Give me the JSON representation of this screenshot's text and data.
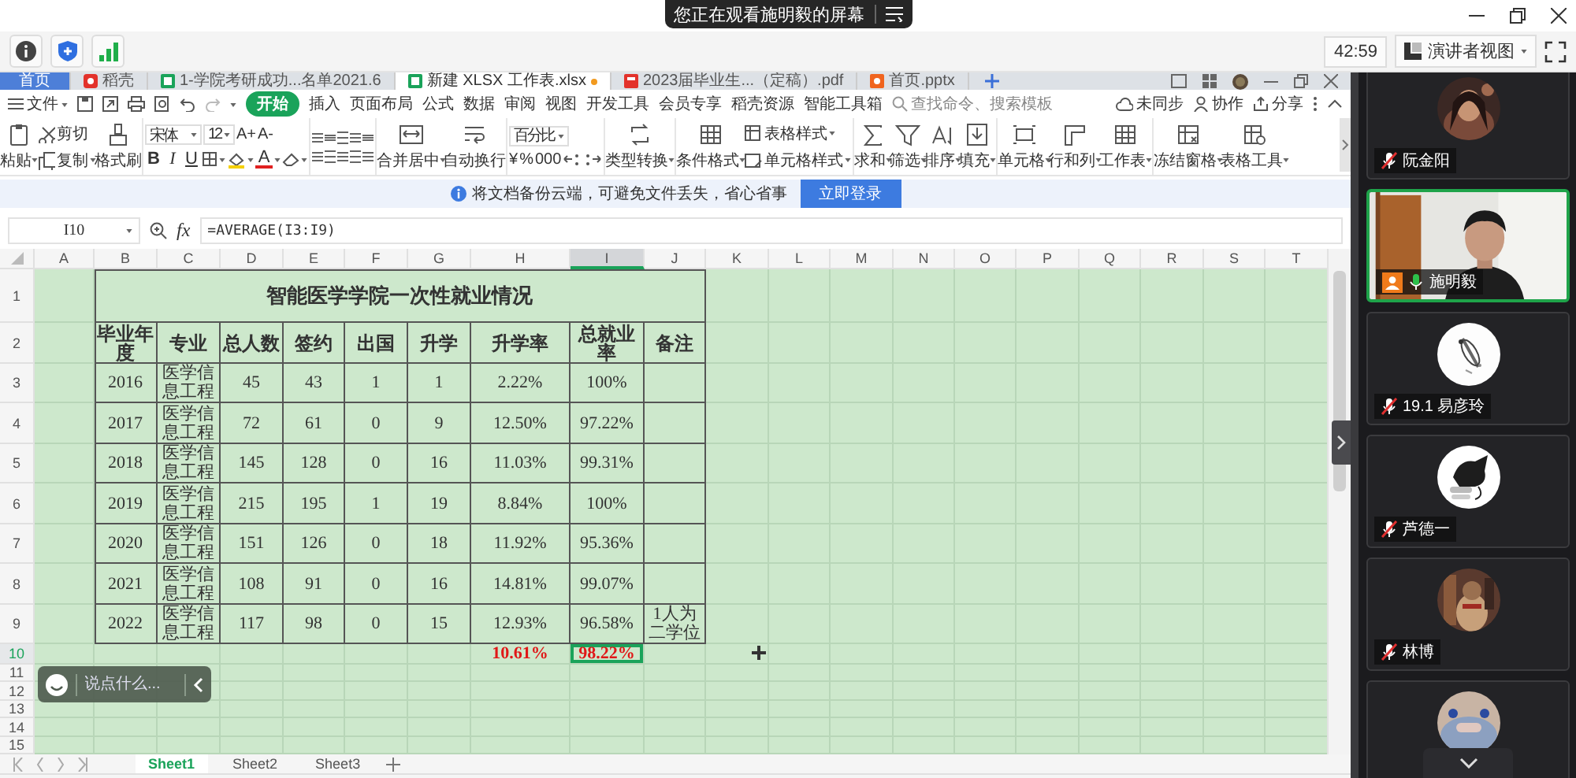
{
  "banner": {
    "text": "您正在观看施明毅的屏幕"
  },
  "meeting_bar": {
    "timer": "42:59",
    "view_button": "演讲者视图"
  },
  "wps": {
    "doc_tabs": [
      {
        "label": "首页",
        "kind": "home",
        "selected": false,
        "modified": false
      },
      {
        "label": "稻壳",
        "kind": "docer",
        "selected": false,
        "modified": false
      },
      {
        "label": "1-学院考研成功...名单2021.6",
        "kind": "sheet",
        "selected": false,
        "modified": false
      },
      {
        "label": "新建 XLSX 工作表.xlsx",
        "kind": "sheet",
        "selected": true,
        "modified": true
      },
      {
        "label": "2023届毕业生...（定稿）.pdf",
        "kind": "pdf",
        "selected": false,
        "modified": false
      },
      {
        "label": "首页.pptx",
        "kind": "ppt",
        "selected": false,
        "modified": false
      }
    ],
    "file_menu": "文件",
    "menu_tabs": [
      {
        "label": "开始",
        "selected": true
      },
      {
        "label": "插入",
        "selected": false
      },
      {
        "label": "页面布局",
        "selected": false
      },
      {
        "label": "公式",
        "selected": false
      },
      {
        "label": "数据",
        "selected": false
      },
      {
        "label": "审阅",
        "selected": false
      },
      {
        "label": "视图",
        "selected": false
      },
      {
        "label": "开发工具",
        "selected": false
      },
      {
        "label": "会员专享",
        "selected": false
      },
      {
        "label": "稻壳资源",
        "selected": false
      },
      {
        "label": "智能工具箱",
        "selected": false
      }
    ],
    "search": {
      "placeholder": "查找命令、搜索模板"
    },
    "actions": [
      "未同步",
      "协作",
      "分享"
    ],
    "ribbon": {
      "clipboard": [
        "粘贴",
        "剪切",
        "复制",
        "格式刷"
      ],
      "font": {
        "name": "宋体",
        "size": "12",
        "size_buttons": [
          "A+",
          "A-"
        ],
        "style_buttons": [
          "B",
          "I",
          "U"
        ],
        "color_button": "A"
      },
      "cells": [
        "合并居中",
        "自动换行"
      ],
      "number": {
        "format": "百分比",
        "buttons": [
          "¥",
          "%",
          "000"
        ]
      },
      "tools": [
        "类型转换",
        "条件格式",
        "表格样式",
        "单元格样式",
        "求和",
        "筛选",
        "排序",
        "填充",
        "单元格",
        "行和列",
        "工作表",
        "冻结窗格",
        "表格工具"
      ]
    },
    "notice": {
      "text": "将文档备份云端，可避免文件丢失，省心省事",
      "button": "立即登录"
    },
    "sheet": {
      "name_box": "I10",
      "fx_label": "fx",
      "formula": "=AVERAGE(I3:I9)",
      "columns": [
        {
          "label": "A",
          "selected": false
        },
        {
          "label": "B",
          "selected": false
        },
        {
          "label": "C",
          "selected": false
        },
        {
          "label": "D",
          "selected": false
        },
        {
          "label": "E",
          "selected": false
        },
        {
          "label": "F",
          "selected": false
        },
        {
          "label": "G",
          "selected": false
        },
        {
          "label": "H",
          "selected": false
        },
        {
          "label": "I",
          "selected": true
        },
        {
          "label": "J",
          "selected": false
        },
        {
          "label": "K",
          "selected": false
        },
        {
          "label": "L",
          "selected": false
        },
        {
          "label": "M",
          "selected": false
        },
        {
          "label": "N",
          "selected": false
        },
        {
          "label": "O",
          "selected": false
        },
        {
          "label": "P",
          "selected": false
        },
        {
          "label": "Q",
          "selected": false
        },
        {
          "label": "R",
          "selected": false
        },
        {
          "label": "S",
          "selected": false
        },
        {
          "label": "T",
          "selected": false
        }
      ],
      "row_numbers": [
        {
          "label": "1",
          "selected": false
        },
        {
          "label": "2",
          "selected": false
        },
        {
          "label": "3",
          "selected": false
        },
        {
          "label": "4",
          "selected": false
        },
        {
          "label": "5",
          "selected": false
        },
        {
          "label": "6",
          "selected": false
        },
        {
          "label": "7",
          "selected": false
        },
        {
          "label": "8",
          "selected": false
        },
        {
          "label": "9",
          "selected": false
        },
        {
          "label": "10",
          "selected": true
        },
        {
          "label": "11",
          "selected": false
        },
        {
          "label": "12",
          "selected": false
        },
        {
          "label": "13",
          "selected": false
        },
        {
          "label": "14",
          "selected": false
        },
        {
          "label": "15",
          "selected": false
        }
      ],
      "title": "智能医学学院一次性就业情况",
      "headers": [
        "毕业年度",
        "专业",
        "总人数",
        "签约",
        "出国",
        "升学",
        "升学率",
        "总就业率",
        "备注"
      ],
      "rows": [
        {
          "year": "2016",
          "major": "医学信息工程",
          "total": "45",
          "signed": "43",
          "abroad": "1",
          "further": "1",
          "further_rate": "2.22%",
          "employment_rate": "100%"
        },
        {
          "year": "2017",
          "major": "医学信息工程",
          "total": "72",
          "signed": "61",
          "abroad": "0",
          "further": "9",
          "further_rate": "12.50%",
          "employment_rate": "97.22%"
        },
        {
          "year": "2018",
          "major": "医学信息工程",
          "total": "145",
          "signed": "128",
          "abroad": "0",
          "further": "16",
          "further_rate": "11.03%",
          "employment_rate": "99.31%"
        },
        {
          "year": "2019",
          "major": "医学信息工程",
          "total": "215",
          "signed": "195",
          "abroad": "1",
          "further": "19",
          "further_rate": "8.84%",
          "employment_rate": "100%"
        },
        {
          "year": "2020",
          "major": "医学信息工程",
          "total": "151",
          "signed": "126",
          "abroad": "0",
          "further": "18",
          "further_rate": "11.92%",
          "employment_rate": "95.36%"
        },
        {
          "year": "2021",
          "major": "医学信息工程",
          "total": "108",
          "signed": "91",
          "abroad": "0",
          "further": "16",
          "further_rate": "14.81%",
          "employment_rate": "99.07%"
        },
        {
          "year": "2022",
          "major": "医学信息工程",
          "total": "117",
          "signed": "98",
          "abroad": "0",
          "further": "15",
          "further_rate": "12.93%",
          "employment_rate": "96.58%",
          "note": "1人为二学位"
        }
      ],
      "summary": [
        {
          "value": "10.61%",
          "selected": false
        },
        {
          "value": "98.22%",
          "selected": true
        }
      ]
    },
    "sheet_tabs": [
      {
        "label": "Sheet1",
        "selected": true
      },
      {
        "label": "Sheet2",
        "selected": false
      },
      {
        "label": "Sheet3",
        "selected": false
      }
    ]
  },
  "chat": {
    "placeholder": "说点什么..."
  },
  "participants": [
    {
      "name": "阮金阳",
      "kind": "avatar",
      "muted": true,
      "host": false,
      "speaking": false
    },
    {
      "name": "施明毅",
      "kind": "video",
      "muted": false,
      "host": true,
      "speaking": true
    },
    {
      "name": "19.1 易彦玲",
      "kind": "avatar",
      "muted": true,
      "host": false,
      "speaking": false
    },
    {
      "name": "芦德一",
      "kind": "avatar",
      "muted": true,
      "host": false,
      "speaking": false
    },
    {
      "name": "林博",
      "kind": "avatar",
      "muted": true,
      "host": false,
      "speaking": false
    },
    {
      "kind": "avatar",
      "host": false,
      "speaking": false
    }
  ]
}
